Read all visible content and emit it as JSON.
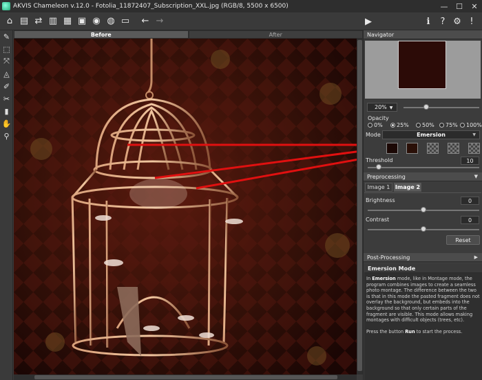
{
  "window": {
    "title": "AKVIS Chameleon v.12.0 - Fotolia_11872407_Subscription_XXL.jpg (RGB/8, 5500 x 6500)",
    "minimize": "—",
    "maximize": "☐",
    "close": "✕"
  },
  "toolbar": {
    "buttons": [
      {
        "name": "home",
        "glyph": "⌂"
      },
      {
        "name": "open",
        "glyph": "▤"
      },
      {
        "name": "swap",
        "glyph": "⇄"
      },
      {
        "name": "save",
        "glyph": "▥"
      },
      {
        "name": "save-as",
        "glyph": "▦"
      },
      {
        "name": "print",
        "glyph": "▣"
      },
      {
        "name": "share",
        "glyph": "◉"
      },
      {
        "name": "batch",
        "glyph": "◍"
      },
      {
        "name": "crop",
        "glyph": "▭"
      },
      {
        "name": "undo",
        "glyph": "←"
      },
      {
        "name": "redo",
        "glyph": "→"
      }
    ],
    "run_glyph": "▶",
    "right_buttons": [
      {
        "name": "info",
        "glyph": "ℹ"
      },
      {
        "name": "help",
        "glyph": "?"
      },
      {
        "name": "settings",
        "glyph": "⚙"
      },
      {
        "name": "notifications",
        "glyph": "!"
      }
    ]
  },
  "tools": [
    "✎",
    "⬚",
    "⤧",
    "◬",
    "✐",
    "✂",
    "▮",
    "✋",
    "⚲"
  ],
  "tabs": {
    "before": "Before",
    "after": "After"
  },
  "navigator": {
    "header": "Navigator",
    "zoom": "20%",
    "zoom_level_fraction": 0.3
  },
  "opacity": {
    "label": "Opacity",
    "options": [
      "0%",
      "25%",
      "50%",
      "75%",
      "100%"
    ],
    "selected": "25%"
  },
  "mode": {
    "label": "Mode",
    "value": "Emersion"
  },
  "threshold": {
    "label": "Threshold",
    "value": "10",
    "fraction": 0.1
  },
  "preprocessing": {
    "header": "Preprocessing",
    "image_tabs": [
      "Image 1",
      "Image 2"
    ],
    "active_tab": "Image 2",
    "brightness": {
      "label": "Brightness",
      "value": "0",
      "fraction": 0.5
    },
    "contrast": {
      "label": "Contrast",
      "value": "0",
      "fraction": 0.5
    },
    "reset_label": "Reset"
  },
  "postprocessing": {
    "header": "Post-Processing"
  },
  "help": {
    "title": "Emersion Mode",
    "para1_pre": "In ",
    "para1_b1": "Emersion",
    "para1_mid": " mode, like in Montage mode, the program combines images to create a seamless photo montage. The difference between the two is that in this mode the pasted fragment does not overlay the background, but embeds into the background so that only certain parts of the fragment are visible. This mode allows making montages with difficult objects (trees, etc).",
    "para2_pre": "Press the button ",
    "para2_b": "Run",
    "para2_post": " to start the process."
  },
  "colors": {
    "accent_red": "#e01010",
    "panel_bg": "#3c3c3c",
    "canvas_bg": "#2a0b06"
  }
}
